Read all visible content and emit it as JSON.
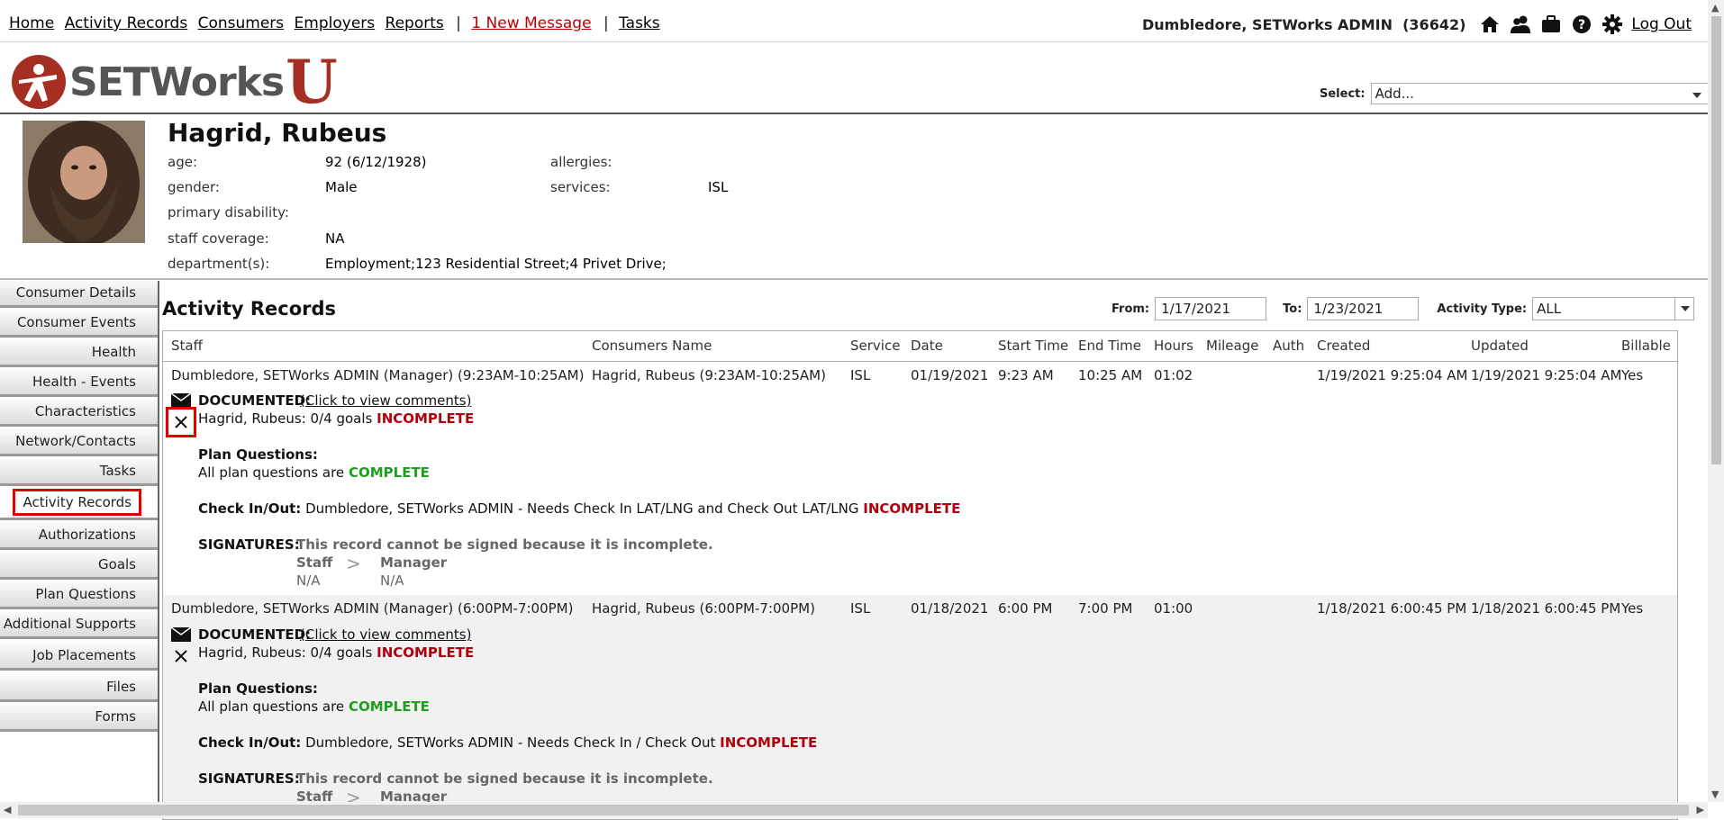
{
  "topnav": {
    "links": [
      "Home",
      "Activity Records",
      "Consumers",
      "Employers",
      "Reports"
    ],
    "message": "1 New Message",
    "tasks": "Tasks",
    "user": "Dumbledore, SETWorks ADMIN",
    "user_id": "(36642)",
    "logout": "Log Out",
    "icons": [
      "home-icon",
      "users-icon",
      "briefcase-icon",
      "help-icon",
      "gear-icon"
    ]
  },
  "logo": {
    "text": "SETWorks",
    "suffix": "U"
  },
  "select": {
    "label": "Select:",
    "value": "Add..."
  },
  "consumer": {
    "name": "Hagrid, Rubeus",
    "fields": {
      "age_label": "age:",
      "age": "92 (6/12/1928)",
      "gender_label": "gender:",
      "gender": "Male",
      "primary_disability_label": "primary disability:",
      "primary_disability": "",
      "staff_coverage_label": "staff coverage:",
      "staff_coverage": "NA",
      "departments_label": "department(s):",
      "departments": "Employment;123 Residential Street;4 Privet Drive;",
      "allergies_label": "allergies:",
      "allergies": "",
      "services_label": "services:",
      "services": "ISL"
    }
  },
  "sidebar": {
    "items": [
      "Consumer Details",
      "Consumer Events",
      "Health",
      "Health - Events",
      "Characteristics",
      "Network/Contacts",
      "Tasks",
      "Activity Records",
      "Authorizations",
      "Goals",
      "Plan Questions",
      "Additional Supports",
      "Job Placements",
      "Files",
      "Forms"
    ],
    "active": "Activity Records"
  },
  "activity": {
    "title": "Activity Records",
    "from_label": "From:",
    "from": "1/17/2021",
    "to_label": "To:",
    "to": "1/23/2021",
    "type_label": "Activity Type:",
    "type": "ALL",
    "columns": [
      "Staff",
      "Consumers Name",
      "Service",
      "Date",
      "Start Time",
      "End Time",
      "Hours",
      "Mileage",
      "Auth",
      "Created",
      "Updated",
      "Billable"
    ],
    "records": [
      {
        "staff": "Dumbledore, SETWorks ADMIN (Manager) (9:23AM-10:25AM)",
        "consumer": "Hagrid, Rubeus (9:23AM-10:25AM)",
        "service": "ISL",
        "date": "01/19/2021",
        "start": "9:23 AM",
        "end": "10:25 AM",
        "hours": "01:02",
        "mileage": "",
        "auth": "",
        "created": "1/19/2021 9:25:04 AM",
        "updated": "1/19/2021 9:25:04 AM",
        "billable": "Yes",
        "documented": "DOCUMENTED:",
        "comments_link": "(Click to view comments)",
        "goals": "Hagrid, Rubeus: 0/4 goals",
        "goals_status": "INCOMPLETE",
        "plan_q_label": "Plan Questions:",
        "plan_q": "All plan questions are",
        "plan_q_status": "COMPLETE",
        "checkin_label": "Check In/Out:",
        "checkin": "Dumbledore, SETWorks ADMIN - Needs Check In LAT/LNG and Check Out LAT/LNG",
        "checkin_status": "INCOMPLETE",
        "sig_label": "SIGNATURES:",
        "sig_note": "This record cannot be signed because it is incomplete.",
        "sig_staff": "Staff",
        "sig_manager": "Manager",
        "sig_staff_val": "N/A",
        "sig_manager_val": "N/A",
        "sig_arrow": ">"
      },
      {
        "staff": "Dumbledore, SETWorks ADMIN (Manager) (6:00PM-7:00PM)",
        "consumer": "Hagrid, Rubeus (6:00PM-7:00PM)",
        "service": "ISL",
        "date": "01/18/2021",
        "start": "6:00 PM",
        "end": "7:00 PM",
        "hours": "01:00",
        "mileage": "",
        "auth": "",
        "created": "1/18/2021 6:00:45 PM",
        "updated": "1/18/2021 6:00:45 PM",
        "billable": "Yes",
        "documented": "DOCUMENTED:",
        "comments_link": "(Click to view comments)",
        "goals": "Hagrid, Rubeus: 0/4 goals",
        "goals_status": "INCOMPLETE",
        "plan_q_label": "Plan Questions:",
        "plan_q": "All plan questions are",
        "plan_q_status": "COMPLETE",
        "checkin_label": "Check In/Out:",
        "checkin": "Dumbledore, SETWorks ADMIN - Needs Check In / Check Out",
        "checkin_status": "INCOMPLETE",
        "sig_label": "SIGNATURES:",
        "sig_note": "This record cannot be signed because it is incomplete.",
        "sig_staff": "Staff",
        "sig_manager": "Manager",
        "sig_arrow": ">"
      }
    ]
  },
  "colors": {
    "brand": "#a52f22",
    "incomplete": "#b0000d",
    "complete": "#1e9e1e",
    "highlight": "#e00000"
  }
}
